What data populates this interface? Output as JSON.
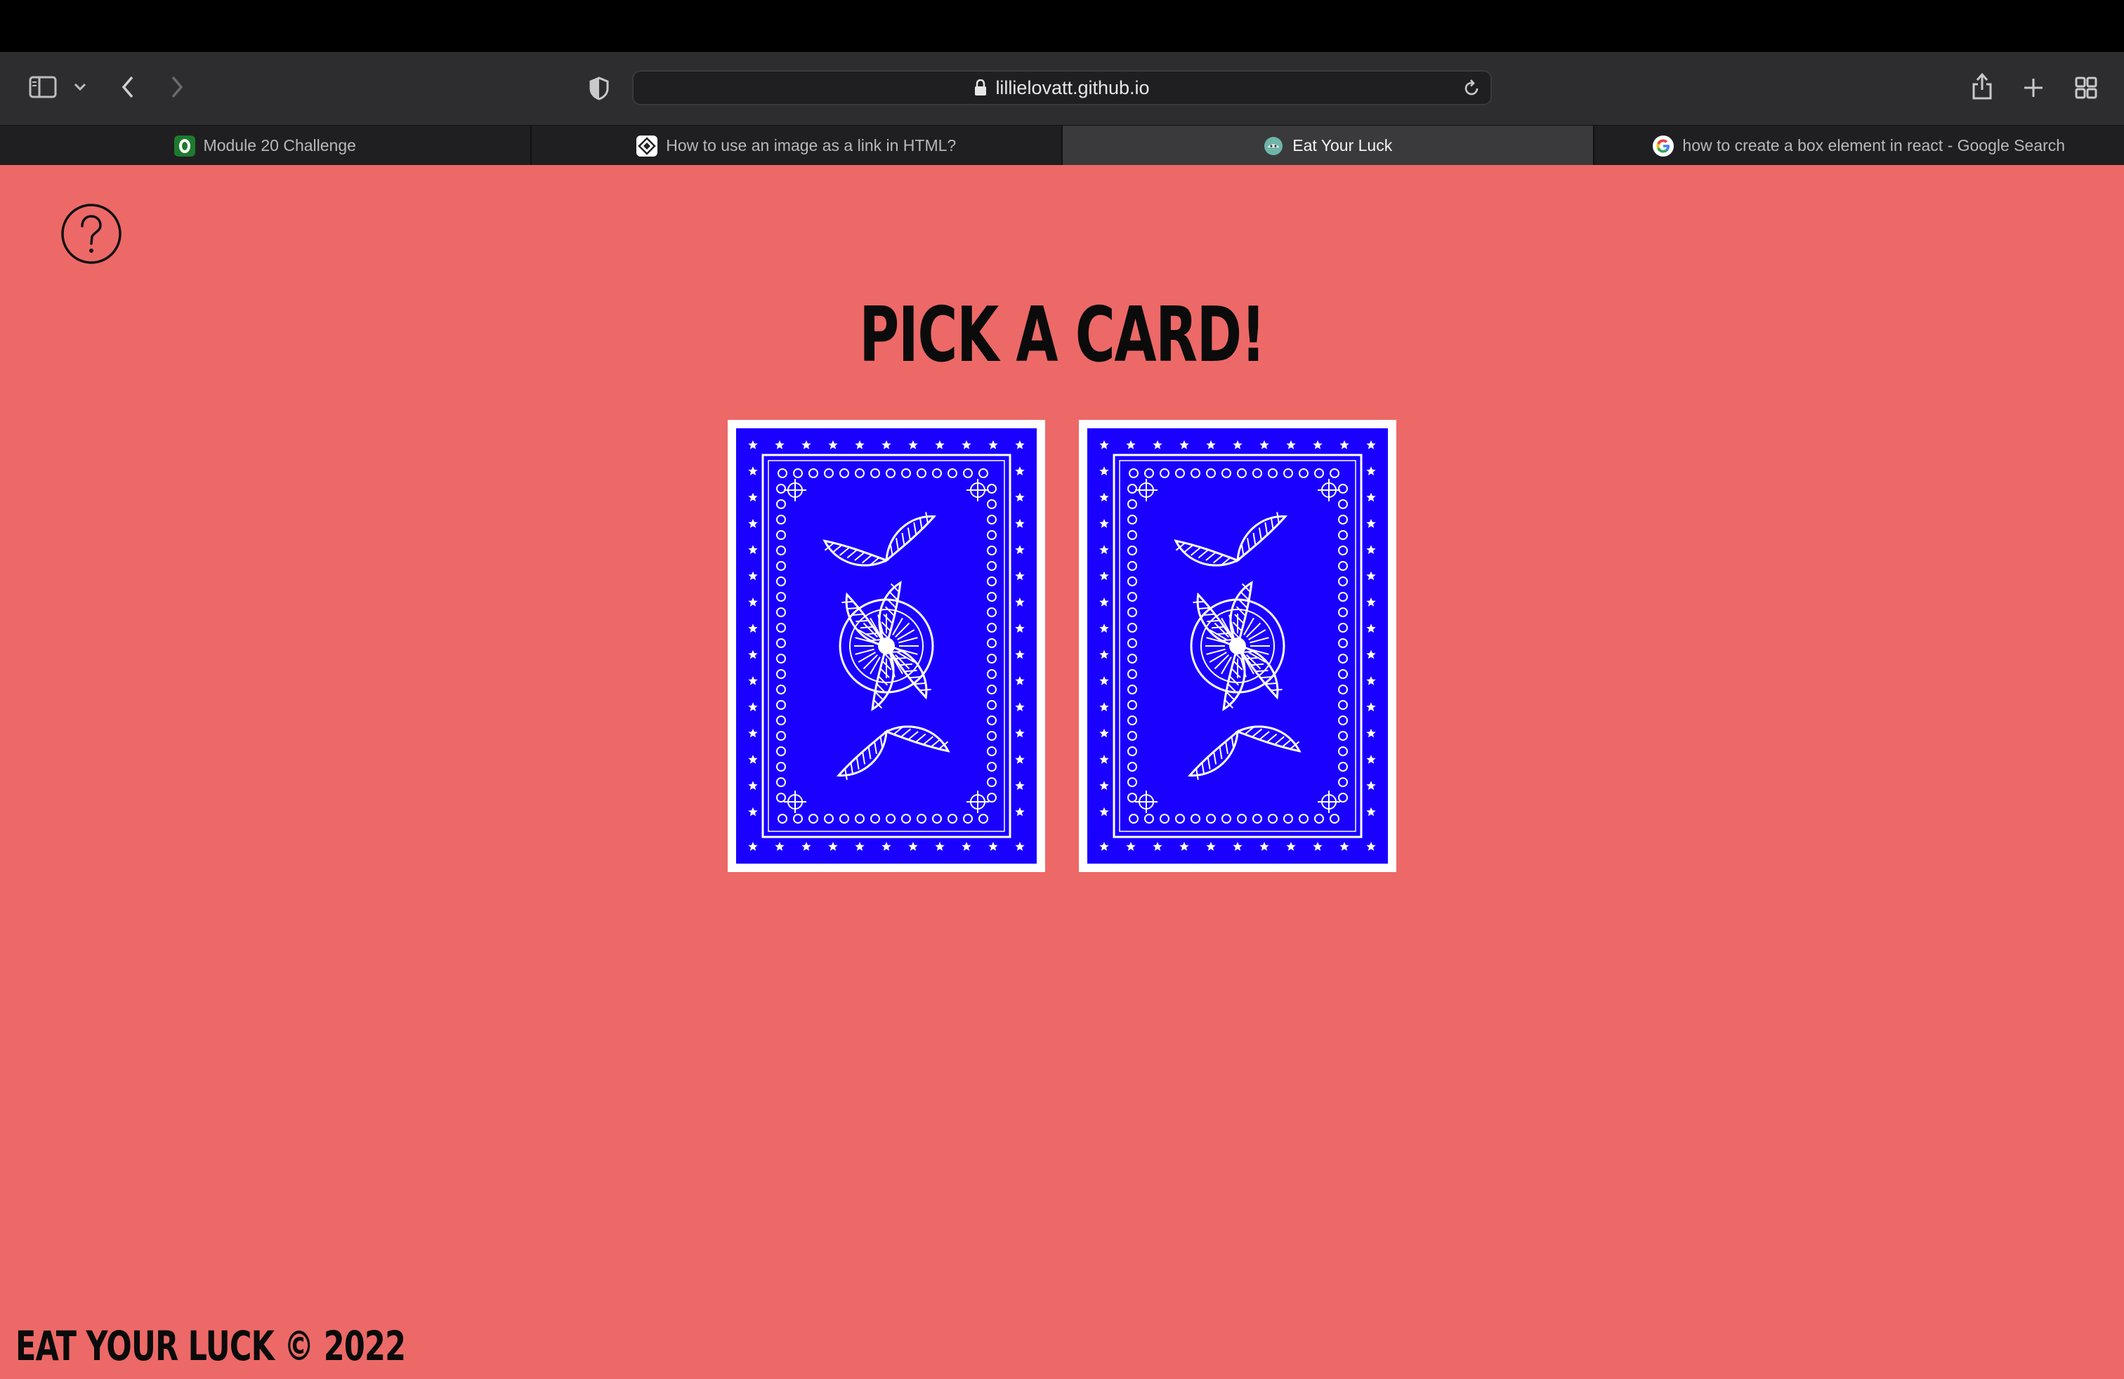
{
  "browser": {
    "url": "lillielovatt.github.io",
    "tabs": [
      {
        "label": "Module 20 Challenge",
        "favicon": "o-logo-icon",
        "active": false
      },
      {
        "label": "How to use an image as a link in HTML?",
        "favicon": "code-diamond-icon",
        "active": false
      },
      {
        "label": "Eat Your Luck",
        "favicon": "site-icon",
        "active": true
      },
      {
        "label": "how to create a box element in react - Google Search",
        "favicon": "google-icon",
        "active": false
      }
    ],
    "toolbar_icons": [
      "sidebar-icon",
      "chevron-down-icon",
      "back-icon",
      "forward-icon",
      "shield-icon",
      "share-icon",
      "new-tab-icon",
      "tab-overview-icon"
    ]
  },
  "page": {
    "background": "#ec6967",
    "help_icon": "question-circle-icon",
    "title": "PICK A CARD!",
    "cards": [
      {
        "name": "card-back",
        "color": "#1a00ff"
      },
      {
        "name": "card-back",
        "color": "#1a00ff"
      }
    ],
    "footer": "EAT YOUR LUCK © 2022"
  }
}
